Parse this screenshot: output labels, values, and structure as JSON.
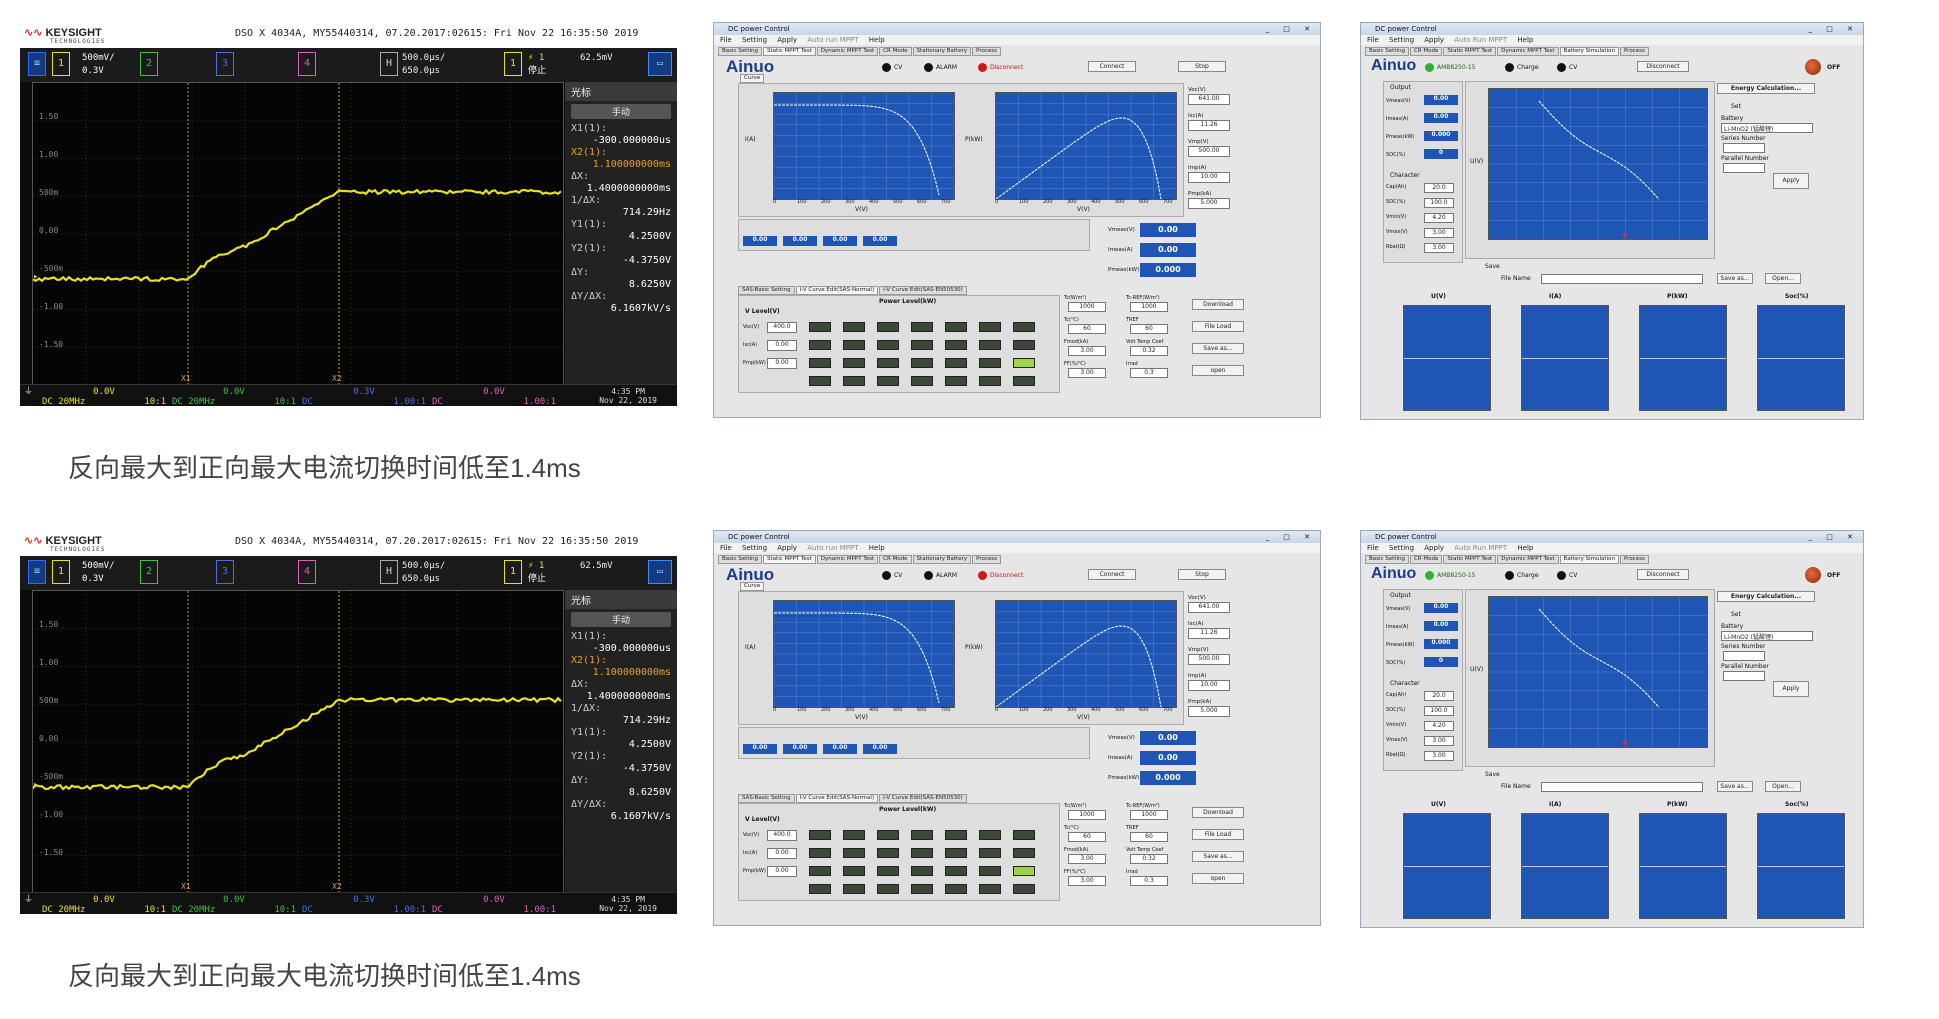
{
  "caption": "反向最大到正向最大电流切换时间低至1.4ms",
  "scope": {
    "brand": "KEYSIGHT",
    "brand_sub": "TECHNOLOGIES",
    "id_line": "DSO X 4034A, MY55440314, 07.20.2017:02615: Fri Nov 22 16:35:50 2019",
    "ch1_scale": "500mV/",
    "ch1_offset": "0.3V",
    "ch2_label": "2",
    "ch3_label": "3",
    "ch4_label": "4",
    "timebase": "500.0µs/",
    "delay": "650.0µs",
    "trig_source": "1",
    "trig_mode": "停止",
    "trig_level": "62.5mV",
    "y_labels": [
      "1.50",
      "1.00",
      "500m",
      "0.00",
      "-500m",
      "-1.00",
      "-1.50"
    ],
    "side_header": "光标",
    "side_mode": "手动",
    "x1_label": "X1(1):",
    "x1_val": "-300.000000us",
    "x2_label": "X2(1):",
    "x2_val": "1.100000000ms",
    "dx_label": "ΔX:",
    "dx_val": "1.4000000000ms",
    "inv_dx_label": "1/ΔX:",
    "inv_dx_val": "714.29Hz",
    "y1_label": "Y1(1):",
    "y1_val": "4.2500V",
    "y2_label": "Y2(1):",
    "y2_val": "-4.3750V",
    "dy_label": "ΔY:",
    "dy_val": "8.6250V",
    "dydx_label": "ΔY/ΔX:",
    "dydx_val": "6.1607kV/s",
    "bottom": [
      {
        "v": "0.0V",
        "s": "DC 20MHz",
        "r": "10:1",
        "c": "#e8e020"
      },
      {
        "v": "0.0V",
        "s": "DC 20MHz",
        "r": "10:1",
        "c": "#40c040"
      },
      {
        "v": "0.3V",
        "s": "DC",
        "r": "1.00:1",
        "c": "#4a70e0"
      },
      {
        "v": "0.0V",
        "s": "DC",
        "r": "1.00:1",
        "c": "#e060c0"
      }
    ],
    "time": "4:35 PM",
    "date": "Nov 22, 2019"
  },
  "pv_window": {
    "title": "DC power Control",
    "menu": [
      "File",
      "Setting",
      "Apply",
      "Auto run MPPT",
      "Help"
    ],
    "tabs": [
      "Basic Setting",
      "Static MPPT Test",
      "Dynamic MPPT Test",
      "CR Mode",
      "Stationary Battery",
      "Process"
    ],
    "logo": "Ainuo",
    "ind_cv": "CV",
    "ind_alarm": "ALARM",
    "ind_disconnect": "Disconnect",
    "btn_connect": "Connect",
    "btn_stop": "Stop",
    "sub_tab": "Curve",
    "plot1_ylabel": "I(A)",
    "plot1_xlabel": "V(V)",
    "plot2_ylabel": "P(kW)",
    "plot2_xlabel": "V(V)",
    "x_ticks": [
      "0",
      "100",
      "200",
      "300",
      "400",
      "500",
      "600",
      "700"
    ],
    "readouts": [
      {
        "l": "Voc(V)",
        "v": "641.00"
      },
      {
        "l": "Isc(A)",
        "v": "11.26"
      },
      {
        "l": "Vmp(V)",
        "v": "500.00"
      },
      {
        "l": "Imp(A)",
        "v": "10.00"
      },
      {
        "l": "Pmp(kA)",
        "v": "5.000"
      }
    ],
    "meas": [
      {
        "l": "Vmeas(V)",
        "v": "0.00"
      },
      {
        "l": "Imeas(A)",
        "v": "0.00"
      },
      {
        "l": "Pmeas(kW)",
        "v": "0.000"
      }
    ],
    "small_vals": [
      "0.00",
      "0.00",
      "0.00",
      "0.00"
    ],
    "bottom_tabs": [
      "SAS-Basic Setting",
      "I-V Curve Edit(SAS-Normal)",
      "I-V Curve Edit(SAS-EN50530)"
    ],
    "power_title": "Power Level(kW)",
    "v_level": "V Level(V)",
    "row_labels": [
      "Voc(V)",
      "Isc(A)",
      "Pmp(kW)"
    ],
    "row_vals": [
      "400.0",
      "0.00",
      "0.00"
    ],
    "param_labels": [
      "Tc(W/m²)",
      "Tc-REF(W/m²)",
      "Tc(°C)",
      "TREF",
      "Fmod(kA)",
      "Volt Temp Coef",
      "FF(%/℃)",
      "Irrad"
    ],
    "param_vals": [
      "1000",
      "1000",
      "60",
      "60",
      "3.00",
      "0.32",
      "3.00",
      "0.3"
    ],
    "side_btns": [
      "Download",
      "File Load",
      "Save as...",
      "open"
    ]
  },
  "bat_window": {
    "title": "DC power Control",
    "menu": [
      "File",
      "Setting",
      "Apply",
      "Auto Run MPPT",
      "Help"
    ],
    "tabs": [
      "Basic Setting",
      "CR Mode",
      "Static MPPT Test",
      "Dynamic MPPT Test",
      "Battery Simulation",
      "Process"
    ],
    "logo": "Ainuo",
    "ind_model": "AMB8250-15",
    "ind_charge": "Charge",
    "ind_cv": "CV",
    "btn_disconnect": "Disconnect",
    "off": "OFF",
    "output": "Output",
    "out_labels": [
      "Vmeas(V)",
      "Imeas(A)",
      "Pmeas(kW)",
      "SOC(%)"
    ],
    "out_vals": [
      "0.00",
      "0.00",
      "0.000",
      "0"
    ],
    "char": "Character",
    "char_labels": [
      "Cap(Ah)",
      "SOC(%)",
      "Vmin(V)",
      "Vmax(V)",
      "Rbat(Ω)"
    ],
    "char_vals": [
      "20.0",
      "100.0",
      "4.20",
      "3.00",
      "3.00"
    ],
    "energy_btn": "Energy Calculation...",
    "set": "Set",
    "battery": "Battery",
    "battery_sel": "Li-MnO2 (锰酸锂)",
    "series": "Series Number",
    "parallel": "Parallel Number",
    "apply": "Apply",
    "save": "Save",
    "file_name": "File Name",
    "save_btn": "Save as...",
    "open_btn": "Open...",
    "bottom_titles": [
      "U(V)",
      "I(A)",
      "P(kW)",
      "Soc(%)"
    ],
    "plot_ylabel": "U(V)"
  }
}
